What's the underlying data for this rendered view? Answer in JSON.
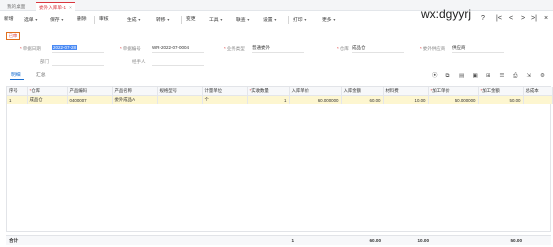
{
  "tabs": [
    {
      "label": "我的桌面",
      "active": false
    },
    {
      "label": "委外入库单-1",
      "active": true,
      "close": "×"
    }
  ],
  "toolbar": [
    {
      "label": "新增"
    },
    {
      "label": "选单",
      "dropdown": true
    },
    {
      "label": "保存",
      "dropdown": true
    },
    {
      "label": "删除"
    },
    {
      "label": "审核"
    },
    {
      "label": "生成",
      "dropdown": true
    },
    {
      "label": "转移",
      "dropdown": true
    },
    {
      "label": "变更"
    },
    {
      "label": "工具",
      "dropdown": true
    },
    {
      "label": "联查",
      "dropdown": true
    },
    {
      "label": "设置",
      "dropdown": true
    },
    {
      "label": "打印",
      "dropdown": true
    },
    {
      "label": "更多",
      "dropdown": true
    }
  ],
  "watermark": "wx:dgyyrj",
  "nav_icons": [
    "?",
    "|<",
    "<",
    ">",
    ">|",
    "×"
  ],
  "status_badge": "已审",
  "form": {
    "date": {
      "label": "单据日期",
      "required": true,
      "value": "2022-07-28"
    },
    "number": {
      "label": "单据编号",
      "required": true,
      "value": "WR-2022-07-0004"
    },
    "biz_type": {
      "label": "业务类型",
      "required": true,
      "value": "普通委外"
    },
    "warehouse": {
      "label": "仓库",
      "required": true,
      "value": "成品仓"
    },
    "supplier": {
      "label": "委外供应商",
      "required": true,
      "value": "供应商"
    },
    "dept": {
      "label": "部门",
      "required": false,
      "value": ""
    },
    "handler": {
      "label": "经手人",
      "required": false,
      "value": ""
    }
  },
  "subtabs": [
    {
      "label": "明细",
      "active": true
    },
    {
      "label": "汇总",
      "active": false
    }
  ],
  "grid_icons": [
    "location-icon",
    "copy-icon",
    "doc-icon",
    "image-icon",
    "table-icon",
    "list-icon",
    "print-icon",
    "export-icon",
    "settings-icon"
  ],
  "columns": [
    {
      "label": "序号",
      "required": false
    },
    {
      "label": "仓库",
      "required": true
    },
    {
      "label": "产品编码",
      "required": false
    },
    {
      "label": "产品名称",
      "required": false
    },
    {
      "label": "规格型号",
      "required": false
    },
    {
      "label": "计量单位",
      "required": false
    },
    {
      "label": "实收数量",
      "required": true
    },
    {
      "label": "入库单价",
      "required": false
    },
    {
      "label": "入库金额",
      "required": false
    },
    {
      "label": "材料费",
      "required": false
    },
    {
      "label": "加工单价",
      "required": true
    },
    {
      "label": "加工金额",
      "required": true
    },
    {
      "label": "总成本",
      "required": false
    }
  ],
  "rows": [
    [
      "1",
      "成品仓",
      "0400007",
      "委外成品A",
      "",
      "个",
      "1",
      "60.000000",
      "60.00",
      "10.00",
      "50.000000",
      "50.00",
      ""
    ]
  ],
  "footer": {
    "label": "合计",
    "qty": "1",
    "amount": "60.00",
    "material": "10.00",
    "processing": "50.00"
  }
}
